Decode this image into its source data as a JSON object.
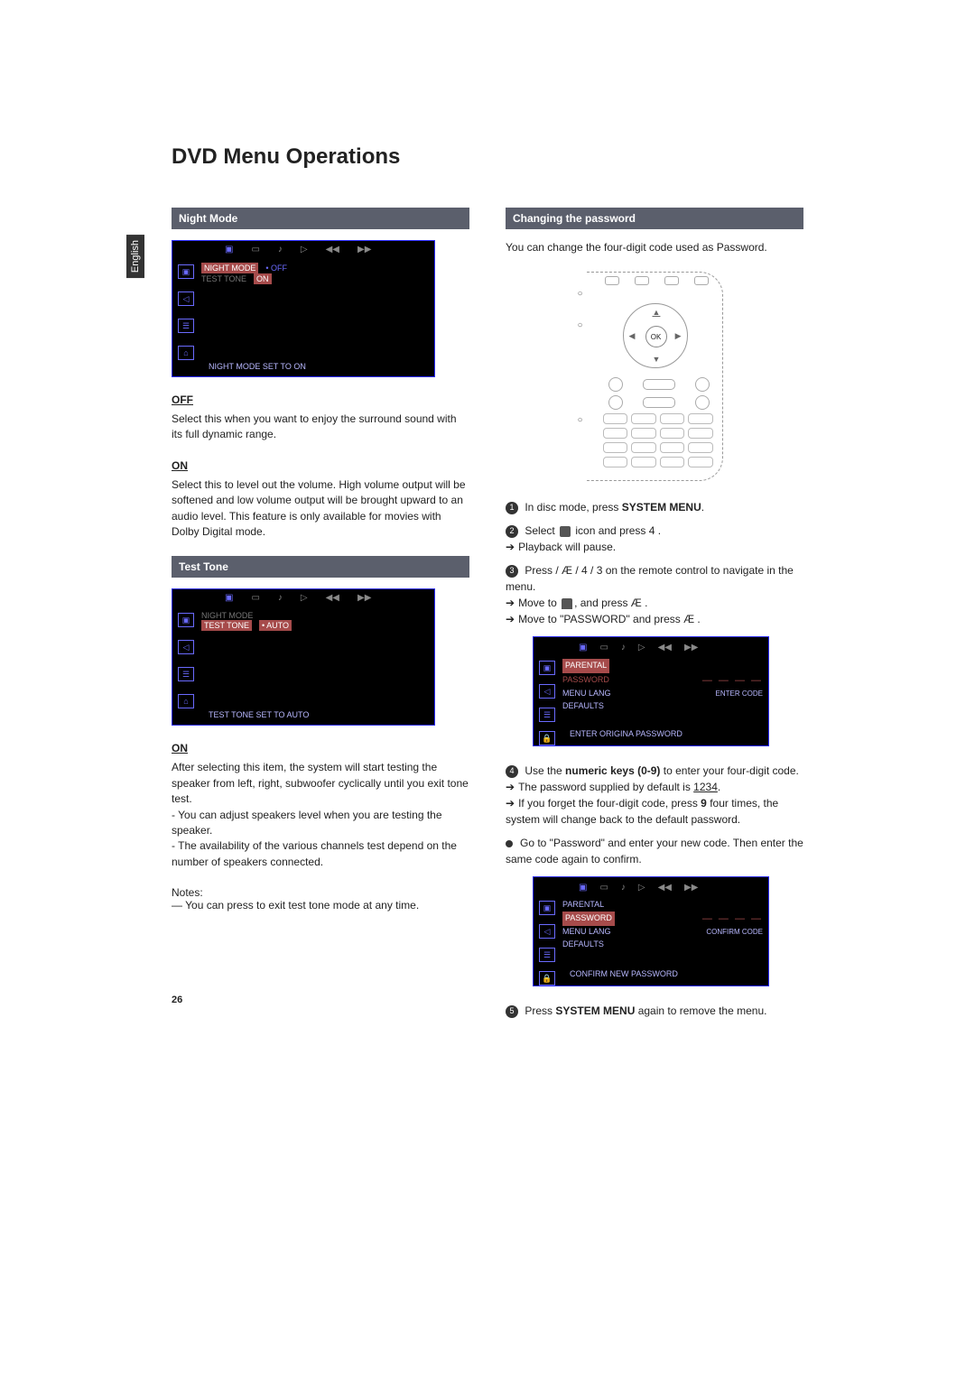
{
  "page": {
    "title": "DVD Menu Operations",
    "side_tab": "English",
    "number": "26"
  },
  "left": {
    "night_mode": {
      "bar": "Night Mode",
      "osd": {
        "item_night": "NIGHT MODE",
        "item_test": "TEST TONE",
        "opt_off": "OFF",
        "opt_on": "ON",
        "status": "NIGHT MODE SET TO ON"
      },
      "off_head": "OFF",
      "off_text": "Select this when you want to enjoy the surround sound with its full dynamic range.",
      "on_head": "ON",
      "on_text": "Select this to level out the volume. High volume output will be softened and low volume output will be brought upward to an audio level. This feature is only available for movies with Dolby Digital mode."
    },
    "test_tone": {
      "bar": "Test Tone",
      "osd": {
        "item_night": "NIGHT MODE",
        "item_test": "TEST TONE",
        "opt_auto": "AUTO",
        "status": "TEST TONE SET TO AUTO"
      },
      "on_head": "ON",
      "on_text": "After selecting this item, the system will start testing the speaker from left,  right,  subwoofer cyclically until you exit tone test.",
      "on_note1": " - You can adjust speakers level when you are testing the speaker.",
      "on_note2": " - The availability of the various channels test depend on the number of speakers connected.",
      "notes_label": "Notes:",
      "notes_text": "—  You can press     to exit test tone mode at any time."
    }
  },
  "right": {
    "bar": "Changing the password",
    "intro": "You can change the four-digit code used as Password.",
    "remote": {
      "ok": "OK"
    },
    "step1_pre": "In disc mode, press ",
    "step1_bold": "SYSTEM MENU",
    "step1_post": ".",
    "step2_pre": "Select ",
    "step2_post": " icon and press 4 .",
    "step2_sub": "Playback will pause.",
    "step3": "Press      / Æ / 4 / 3   on the remote control to navigate in the menu.",
    "step3_sub1_pre": "Move to ",
    "step3_sub1_post": ", and press Æ .",
    "step3_sub2": "Move to \"PASSWORD\" and press Æ .",
    "osd1": {
      "m1": "PARENTAL",
      "m2": "PASSWORD",
      "m3": "MENU LANG",
      "m4": "DEFAULTS",
      "enter": "ENTER CODE",
      "dash": "— — — —",
      "status": "ENTER ORIGINA PASSWORD"
    },
    "step4_pre": "Use the ",
    "step4_bold": "numeric keys (0-9)",
    "step4_post": " to enter your four-digit code.",
    "step4_sub1_pre": "The password supplied by default is ",
    "step4_sub1_u": "1234",
    "step4_sub1_post": ".",
    "step4_sub2_pre": "If you forget the four-digit code, press ",
    "step4_sub2_b": "9",
    "step4_sub2_post": " four times, the system will change back to the default password.",
    "bullet": "Go to \"Password\" and enter your new code. Then enter the same code again to confirm.",
    "osd2": {
      "m1": "PARENTAL",
      "m2": "PASSWORD",
      "m3": "MENU LANG",
      "m4": "DEFAULTS",
      "confirm": "CONFIRM CODE",
      "dash": "— — — —",
      "status": "CONFIRM NEW PASSWORD"
    },
    "step5_pre": "Press ",
    "step5_bold": "SYSTEM MENU",
    "step5_post": " again to remove the menu."
  }
}
